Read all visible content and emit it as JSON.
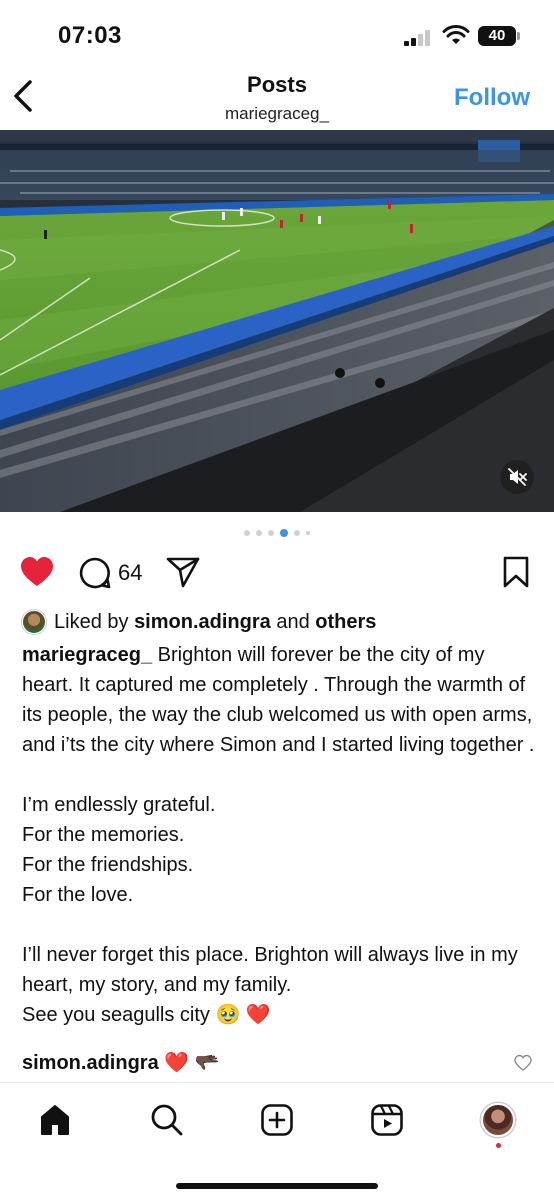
{
  "status_bar": {
    "time": "07:03",
    "battery": "40"
  },
  "header": {
    "title": "Posts",
    "username": "mariegraceg_",
    "follow_label": "Follow"
  },
  "post": {
    "carousel": {
      "total": 6,
      "active_index": 3
    },
    "liked": true,
    "comment_count": "64",
    "liked_by": {
      "prefix": "Liked by",
      "user": "simon.adingra",
      "connector": "and",
      "others": "others"
    },
    "caption": {
      "author": "mariegraceg_",
      "paragraphs": [
        "Brighton will forever be the city of my heart. It captured me completely . Through the warmth of its people, the way the club welcomed us with open arms, and i’ts the city where Simon and I started living together .",
        "I’m endlessly grateful.",
        "For the memories.",
        "For the friendships.",
        "For the love.",
        "I’ll never forget this place. Brighton will always live in my heart, my story, and my family.",
        "See you seagulls city 🥹 ❤️"
      ]
    },
    "top_comment": {
      "user": "simon.adingra",
      "text": "❤️ 🫳🏿"
    }
  },
  "icons": {
    "back": "chevron-left-icon",
    "mute": "speaker-muted-icon",
    "like": "heart-icon",
    "comment": "comment-bubble-icon",
    "share": "paper-plane-icon",
    "save": "bookmark-icon",
    "nav": [
      "home-icon",
      "search-icon",
      "plus-square-icon",
      "reels-icon",
      "profile-avatar"
    ]
  },
  "colors": {
    "accent": "#3b94e6",
    "like": "#e5243b"
  }
}
